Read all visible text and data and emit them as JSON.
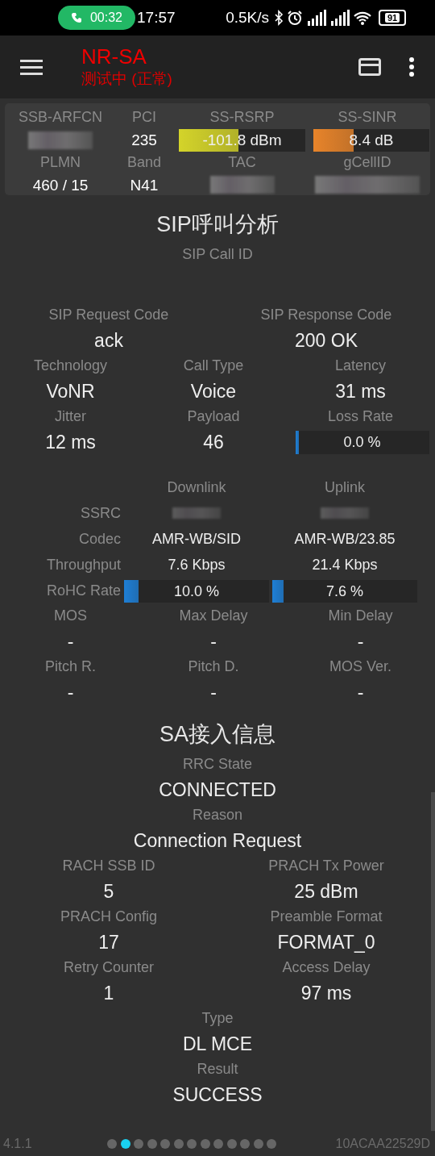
{
  "status_bar": {
    "call_timer": "00:32",
    "time": "17:57",
    "net_speed": "0.5K/s",
    "battery": "91"
  },
  "app_bar": {
    "title": "NR-SA",
    "subtitle": "测试中 (正常)"
  },
  "cell_info": {
    "rows": [
      [
        {
          "label": "SSB-ARFCN",
          "kind": "blurred"
        },
        {
          "label": "PCI",
          "kind": "text",
          "value": "235"
        },
        {
          "label": "SS-RSRP",
          "kind": "meter",
          "value": "-101.8 dBm",
          "level": 0.47,
          "color": "#d4d42a"
        },
        {
          "label": "SS-SINR",
          "kind": "meter",
          "value": "8.4 dB",
          "level": 0.35,
          "color": "#e8842a"
        }
      ],
      [
        {
          "label": "PLMN",
          "kind": "text",
          "value": "460 / 15"
        },
        {
          "label": "Band",
          "kind": "text",
          "value": "N41"
        },
        {
          "label": "TAC",
          "kind": "blurred"
        },
        {
          "label": "gCellID",
          "kind": "blurred"
        }
      ]
    ]
  },
  "sip": {
    "title": "SIP呼叫分析",
    "call_id": {
      "label": "SIP Call ID"
    },
    "codes": [
      [
        {
          "label": "SIP Request Code",
          "kind": "text",
          "value": "ack"
        },
        {
          "label": "SIP Response Code",
          "kind": "text",
          "value": "200 OK"
        }
      ]
    ],
    "rows": [
      [
        {
          "label": "Technology",
          "kind": "text",
          "value": "VoNR"
        },
        {
          "label": "Call Type",
          "kind": "text",
          "value": "Voice"
        },
        {
          "label": "Latency",
          "kind": "text",
          "value": "31 ms"
        }
      ],
      [
        {
          "label": "Jitter",
          "kind": "text",
          "value": "12 ms"
        },
        {
          "label": "Payload",
          "kind": "text",
          "value": "46"
        },
        {
          "label": "Loss Rate",
          "kind": "meter",
          "value": "0.0 %",
          "level": 0,
          "color": "#1e7fd6"
        }
      ]
    ]
  },
  "streams": {
    "columns": [
      "Downlink",
      "Uplink"
    ],
    "rows": [
      {
        "label": "SSRC",
        "kind": "blurred"
      },
      {
        "label": "Codec",
        "kind": "text",
        "values": [
          "AMR-WB/SID",
          "AMR-WB/23.85"
        ]
      },
      {
        "label": "Throughput",
        "kind": "text",
        "values": [
          "7.6 Kbps",
          "21.4 Kbps"
        ]
      },
      {
        "label": "RoHC Rate",
        "kind": "meter",
        "values": [
          {
            "value": "10.0 %",
            "level": 0.1,
            "color": "#1e7fd6"
          },
          {
            "value": "7.6 %",
            "level": 0.076,
            "color": "#1e7fd6"
          }
        ]
      }
    ]
  },
  "quality": {
    "rows": [
      [
        {
          "label": "MOS",
          "kind": "text",
          "value": "-"
        },
        {
          "label": "Max Delay",
          "kind": "text",
          "value": "-"
        },
        {
          "label": "Min Delay",
          "kind": "text",
          "value": "-"
        }
      ],
      [
        {
          "label": "Pitch R.",
          "kind": "text",
          "value": "-"
        },
        {
          "label": "Pitch D.",
          "kind": "text",
          "value": "-"
        },
        {
          "label": "MOS Ver.",
          "kind": "text",
          "value": "-"
        }
      ]
    ]
  },
  "sa": {
    "title": "SA接入信息",
    "rows": [
      [
        {
          "label": "RRC State",
          "kind": "text",
          "value": "CONNECTED"
        }
      ],
      [
        {
          "label": "Reason",
          "kind": "text",
          "value": "Connection Request"
        }
      ],
      [
        {
          "label": "RACH SSB ID",
          "kind": "text",
          "value": "5"
        },
        {
          "label": "PRACH Tx Power",
          "kind": "text",
          "value": "25 dBm"
        }
      ],
      [
        {
          "label": "PRACH Config",
          "kind": "text",
          "value": "17"
        },
        {
          "label": "Preamble Format",
          "kind": "text",
          "value": "FORMAT_0"
        }
      ],
      [
        {
          "label": "Retry Counter",
          "kind": "text",
          "value": "1"
        },
        {
          "label": "Access Delay",
          "kind": "text",
          "value": "97 ms"
        }
      ],
      [
        {
          "label": "Type",
          "kind": "text",
          "value": "DL MCE"
        }
      ],
      [
        {
          "label": "Result",
          "kind": "text",
          "value": "SUCCESS"
        }
      ]
    ]
  },
  "footer": {
    "version": "4.1.1",
    "device_id": "10ACAA22529D",
    "pages": [
      {
        "selected": false
      },
      {
        "selected": true
      },
      {
        "selected": false
      },
      {
        "selected": false
      },
      {
        "selected": false
      },
      {
        "selected": false
      },
      {
        "selected": false
      },
      {
        "selected": false
      },
      {
        "selected": false
      },
      {
        "selected": false
      },
      {
        "selected": false
      },
      {
        "selected": false
      },
      {
        "selected": false
      }
    ]
  }
}
